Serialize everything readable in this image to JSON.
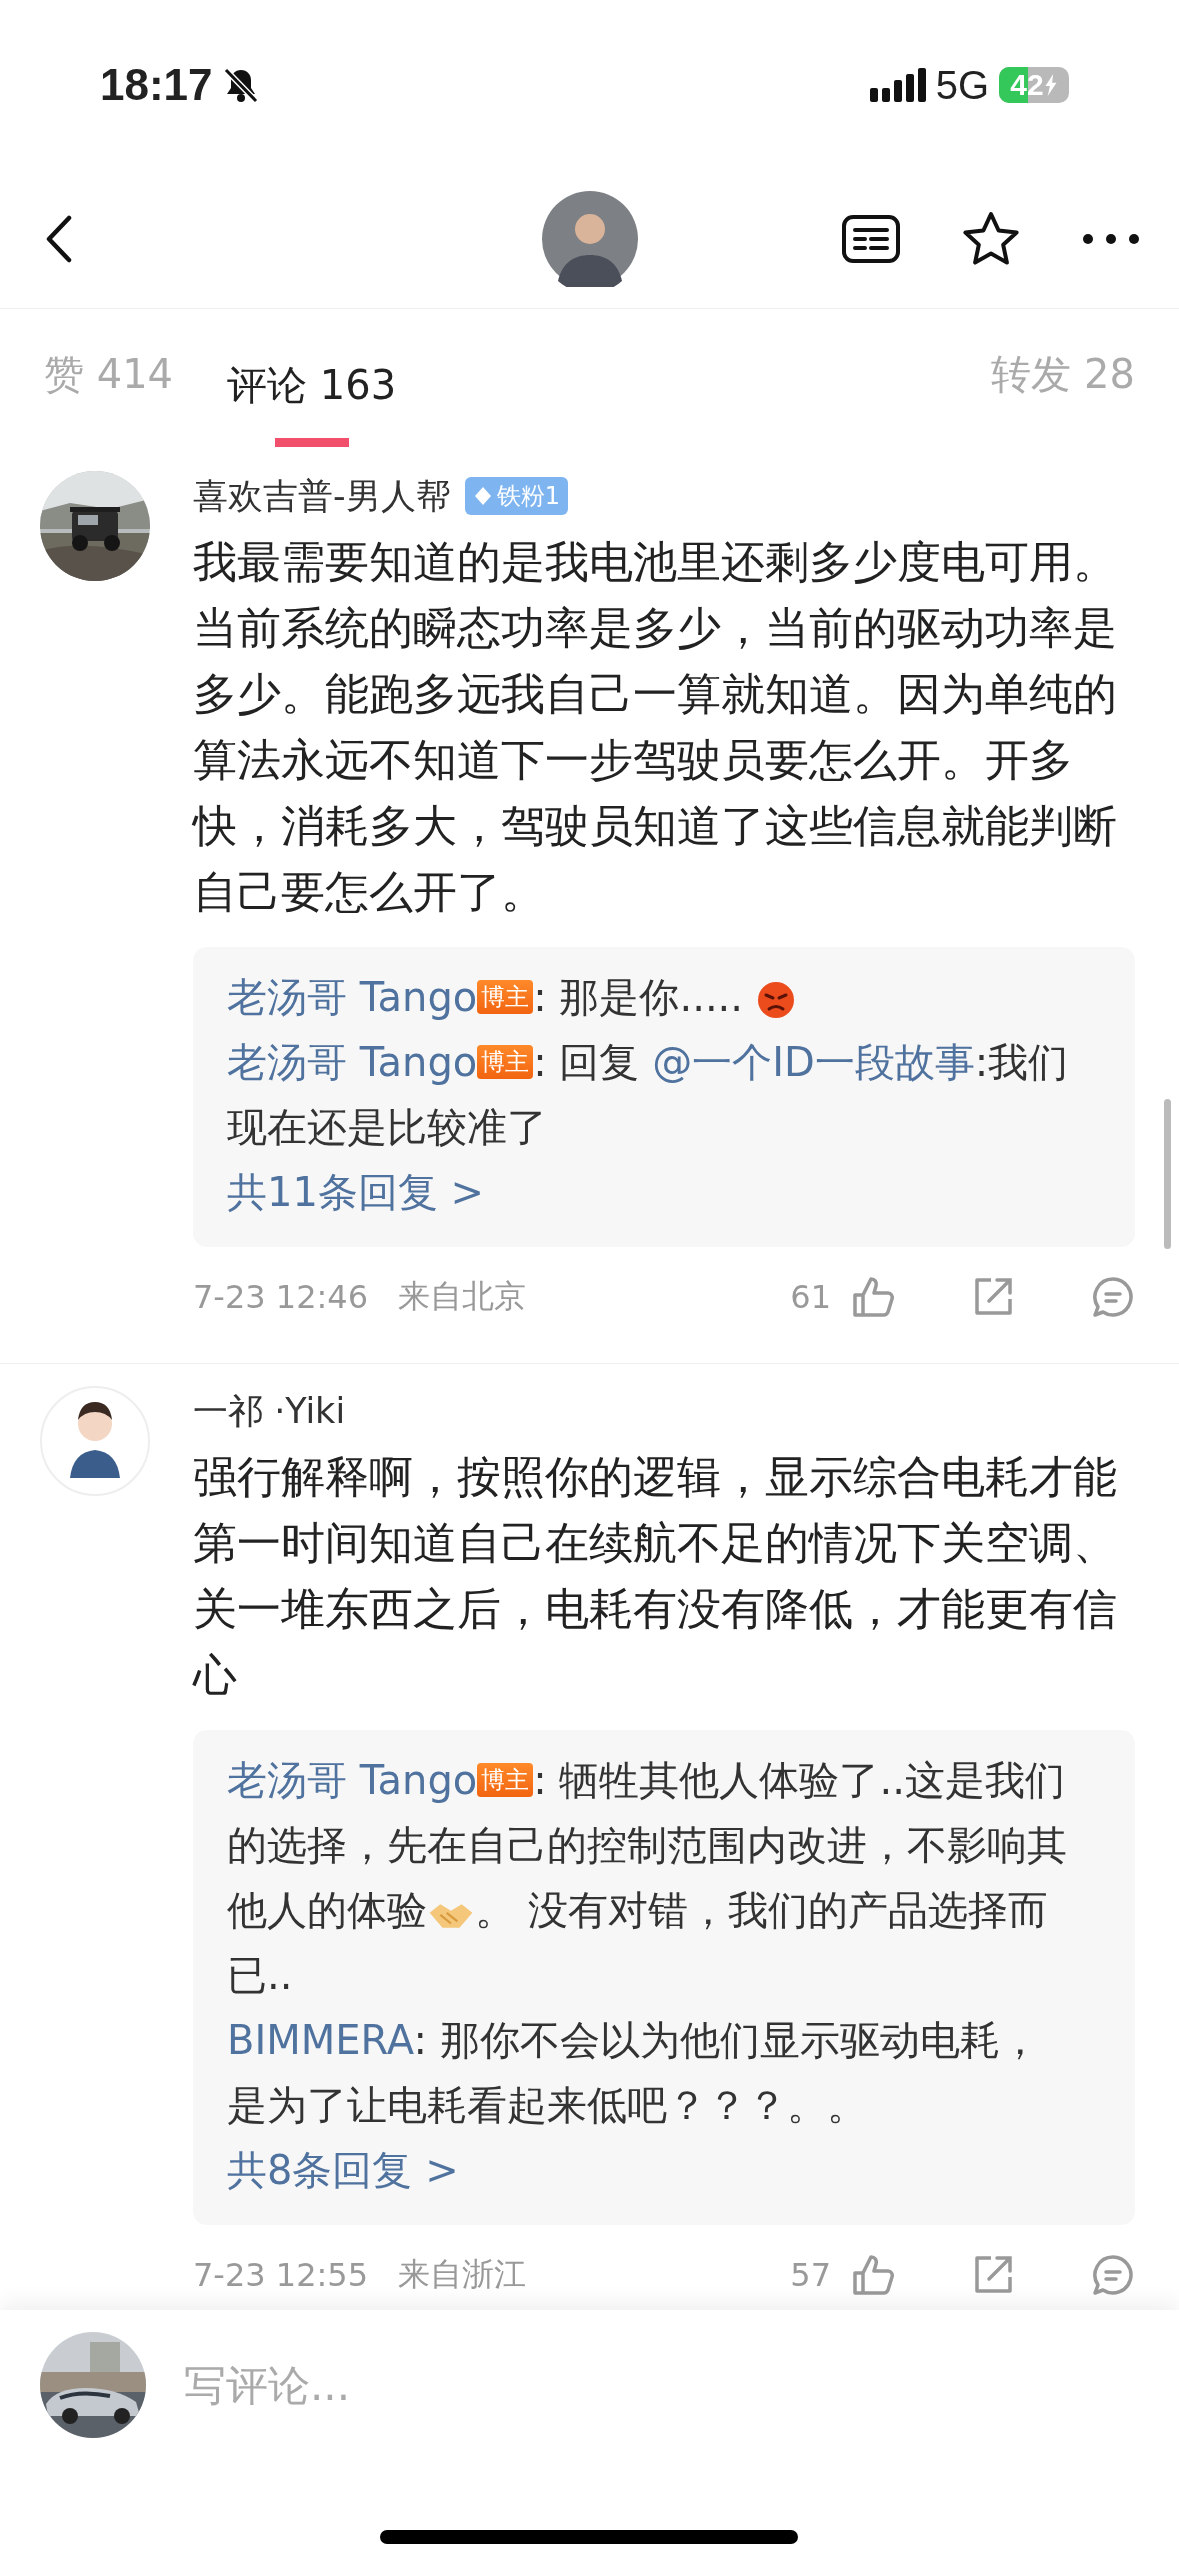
{
  "status_bar": {
    "time": "18:17",
    "network": "5G",
    "battery": "42"
  },
  "tabs": [
    {
      "label": "赞 414",
      "selected": false
    },
    {
      "label": "评论 163",
      "selected": true
    },
    {
      "label": "转发 28",
      "selected": false
    }
  ],
  "comments": [
    {
      "avatar": {
        "kind": "picture"
      },
      "name": "喜欢吉普-男人帮",
      "fan_badge": "铁粉1",
      "body": "我最需要知道的是我电池里还剩多少度电可用。当前系统的瞬态功率是多少，当前的驱动功率是多少。能跑多远我自己一算就知道。因为单纯的算法永远不知道下一步驾驶员要怎么开。开多快，消耗多大，驾驶员知道了这些信息就能判断自己要怎么开了。",
      "replies": [
        {
          "author": "老汤哥 Tango",
          "badge": "博主",
          "segments": [
            {
              "kind": "text",
              "text": ": 那是你..... "
            },
            {
              "kind": "angry-emoji"
            }
          ]
        },
        {
          "author": "老汤哥 Tango",
          "badge": "博主",
          "segments": [
            {
              "kind": "text",
              "text": ": 回复 "
            },
            {
              "kind": "mention",
              "text": "@一个ID一段故事"
            },
            {
              "kind": "text",
              "text": ":我们现在还是比较准了"
            }
          ]
        }
      ],
      "more_replies": "共11条回复 >",
      "time": "7-23 12:46",
      "location": "来自北京",
      "likes": "61"
    },
    {
      "avatar": {
        "kind": "cartoon"
      },
      "name": "一祁 ·Yiki",
      "body": "强行解释啊，按照你的逻辑，显示综合电耗才能第一时间知道自己在续航不足的情况下关空调、关一堆东西之后，电耗有没有降低，才能更有信心",
      "replies": [
        {
          "author": "老汤哥 Tango",
          "badge": "博主",
          "segments": [
            {
              "kind": "text",
              "text": ": 牺牲其他人体验了..这是我们的选择，先在自己的控制范围内改进，不影响其他人的体验"
            },
            {
              "kind": "handshake-emoji"
            },
            {
              "kind": "text",
              "text": "。 没有对错，我们的产品选择而已.."
            }
          ]
        },
        {
          "author": "BIMMERA",
          "segments": [
            {
              "kind": "text",
              "text": ": 那你不会以为他们显示驱动电耗，是为了让电耗看起来低吧？？？。。"
            }
          ]
        }
      ],
      "more_replies": "共8条回复 >",
      "time": "7-23 12:55",
      "location": "来自浙江",
      "likes": "57"
    }
  ],
  "composer": {
    "placeholder": "写评论..."
  }
}
